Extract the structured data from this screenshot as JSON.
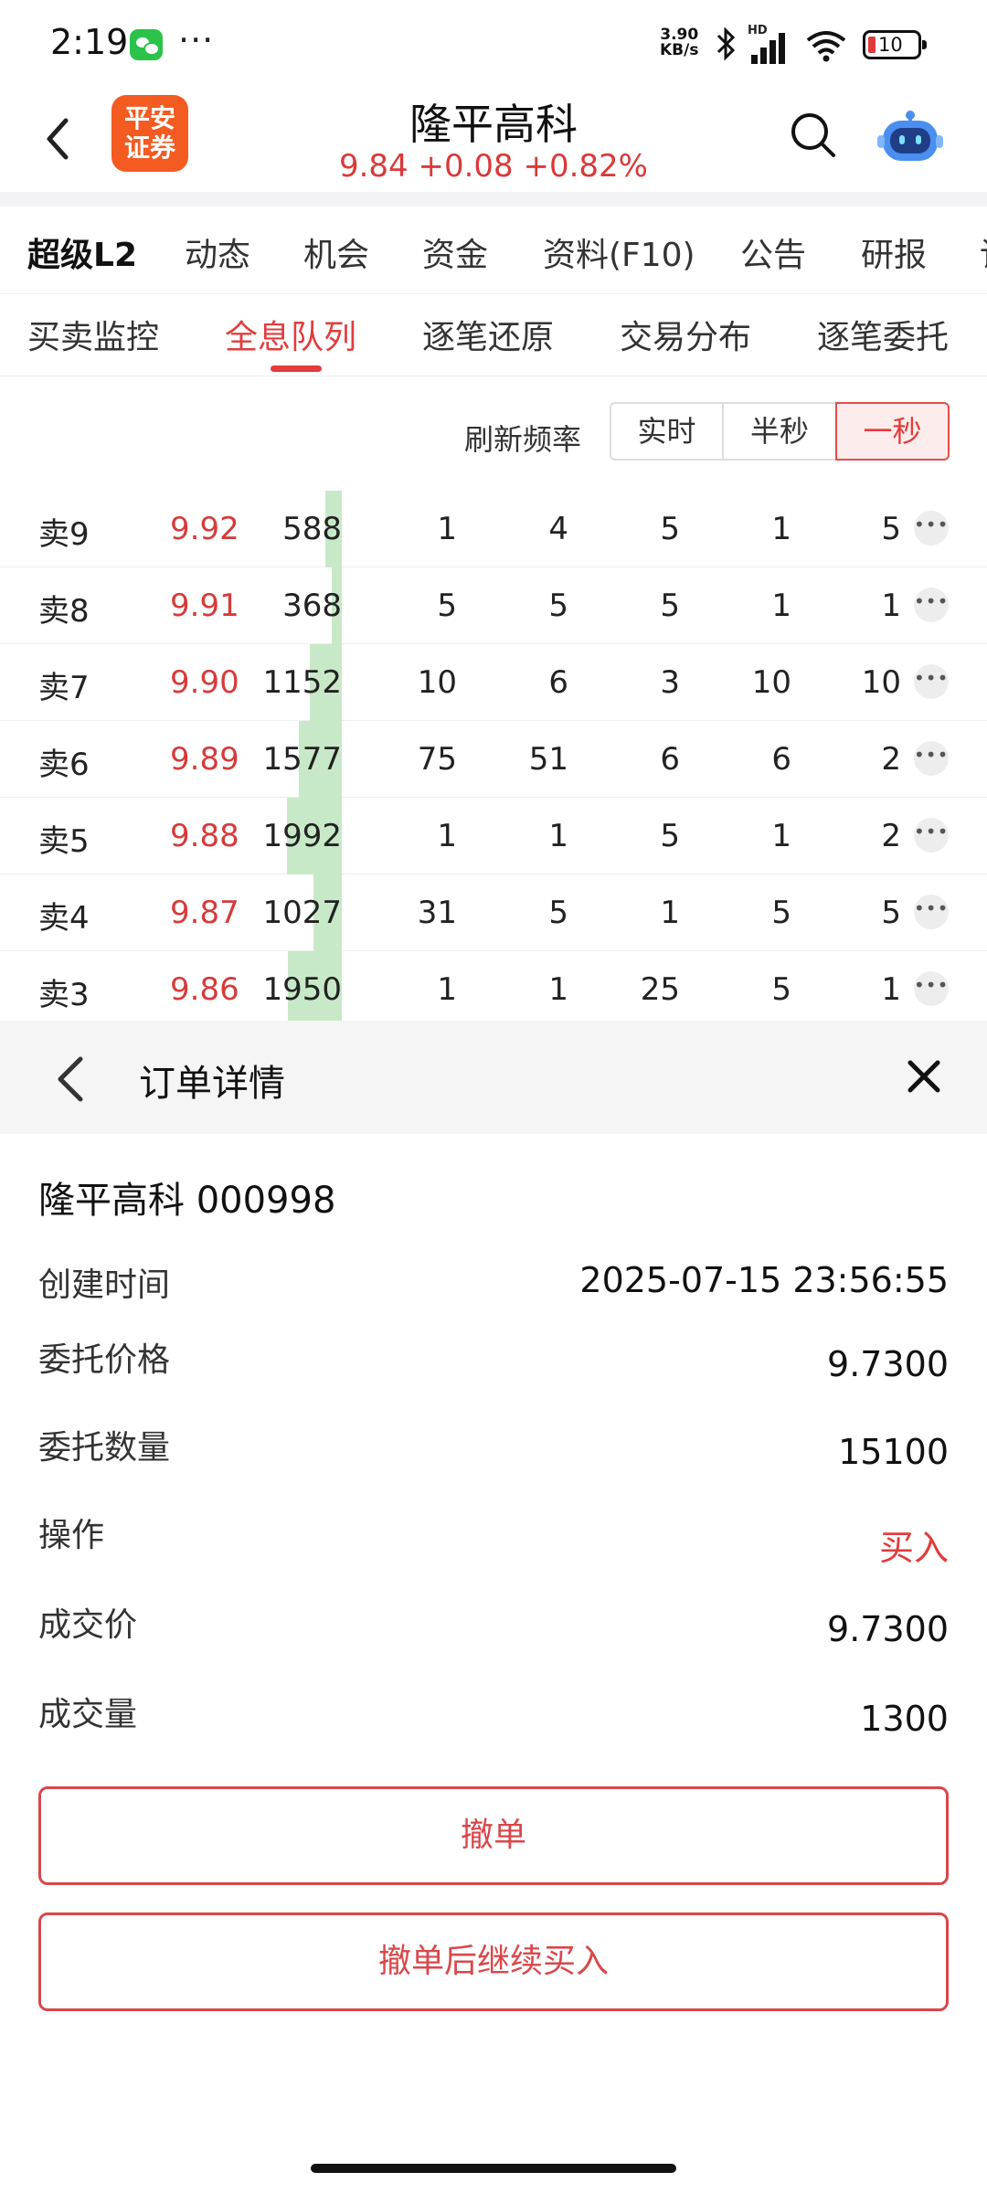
{
  "status_bar": {
    "time": "2:19",
    "dots": "···",
    "net_speed_top": "3.90",
    "net_speed_bottom": "KB/s",
    "hd": "HD",
    "battery": "10"
  },
  "header": {
    "logo_line1": "平安",
    "logo_line2": "证券",
    "title": "隆平高科",
    "quote": "9.84  +0.08  +0.82%"
  },
  "main_tabs": [
    "超级L2",
    "动态",
    "机会",
    "资金",
    "资料(F10)",
    "公告",
    "研报",
    "讨"
  ],
  "sub_tabs": [
    "买卖监控",
    "全息队列",
    "逐笔还原",
    "交易分布",
    "逐笔委托"
  ],
  "refresh": {
    "label": "刷新频率",
    "options": [
      "实时",
      "半秒",
      "一秒"
    ],
    "selected": "一秒"
  },
  "order_book": [
    {
      "label": "卖9",
      "price": "9.92",
      "volume": "588",
      "queue": [
        "1",
        "4",
        "5",
        "1",
        "5"
      ]
    },
    {
      "label": "卖8",
      "price": "9.91",
      "volume": "368",
      "queue": [
        "5",
        "5",
        "5",
        "1",
        "1"
      ]
    },
    {
      "label": "卖7",
      "price": "9.90",
      "volume": "1152",
      "queue": [
        "10",
        "6",
        "3",
        "10",
        "10"
      ]
    },
    {
      "label": "卖6",
      "price": "9.89",
      "volume": "1577",
      "queue": [
        "75",
        "51",
        "6",
        "6",
        "2"
      ]
    },
    {
      "label": "卖5",
      "price": "9.88",
      "volume": "1992",
      "queue": [
        "1",
        "1",
        "5",
        "1",
        "2"
      ]
    },
    {
      "label": "卖4",
      "price": "9.87",
      "volume": "1027",
      "queue": [
        "31",
        "5",
        "1",
        "5",
        "5"
      ]
    },
    {
      "label": "卖3",
      "price": "9.86",
      "volume": "1950",
      "queue": [
        "1",
        "1",
        "25",
        "5",
        "1"
      ]
    }
  ],
  "order_detail": {
    "title": "订单详情",
    "stock": "隆平高科 000998",
    "rows": [
      {
        "label": "创建时间",
        "value": "2025-07-15 23:56:55"
      },
      {
        "label": "委托价格",
        "value": "9.7300"
      },
      {
        "label": "委托数量",
        "value": "15100"
      },
      {
        "label": "操作",
        "value": "买入"
      },
      {
        "label": "成交价",
        "value": "9.7300"
      },
      {
        "label": "成交量",
        "value": "1300"
      }
    ],
    "cancel_label": "撤单",
    "cancel_and_buy_label": "撤单后继续买入"
  },
  "colors": {
    "accent_red": "#e23c3c",
    "volume_bar": "#c8e9c8",
    "brand_orange": "#f35b21"
  }
}
